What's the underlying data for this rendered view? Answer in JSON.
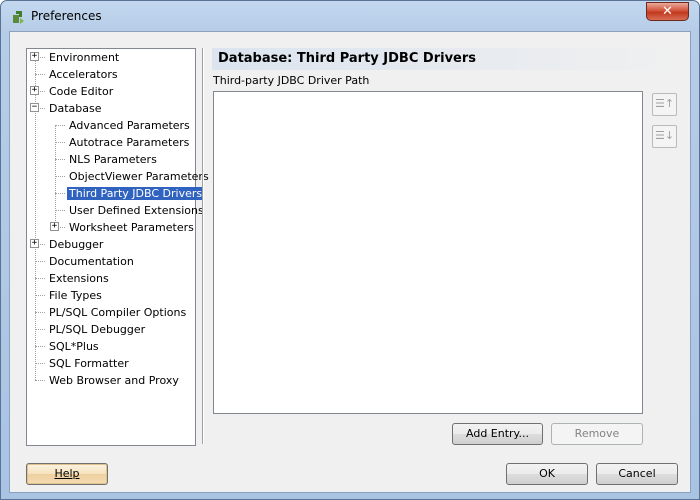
{
  "window": {
    "title": "Preferences",
    "close_glyph": "✕"
  },
  "tree": {
    "items": [
      {
        "label": "Environment",
        "expander": "+"
      },
      {
        "label": "Accelerators"
      },
      {
        "label": "Code Editor",
        "expander": "+"
      },
      {
        "label": "Database",
        "expander": "−"
      },
      {
        "label": "Advanced Parameters"
      },
      {
        "label": "Autotrace Parameters"
      },
      {
        "label": "NLS Parameters"
      },
      {
        "label": "ObjectViewer Parameters"
      },
      {
        "label": "Third Party JDBC Drivers",
        "selected": true
      },
      {
        "label": "User Defined Extensions"
      },
      {
        "label": "Worksheet Parameters",
        "expander": "+"
      },
      {
        "label": "Debugger",
        "expander": "+"
      },
      {
        "label": "Documentation"
      },
      {
        "label": "Extensions"
      },
      {
        "label": "File Types"
      },
      {
        "label": "PL/SQL Compiler Options"
      },
      {
        "label": "PL/SQL Debugger"
      },
      {
        "label": "SQL*Plus"
      },
      {
        "label": "SQL Formatter"
      },
      {
        "label": "Web Browser and Proxy"
      }
    ]
  },
  "panel": {
    "title": "Database: Third Party JDBC Drivers",
    "field_label": "Third-party JDBC Driver Path",
    "move_up_glyph": "☰↑",
    "move_down_glyph": "☰↓",
    "add_entry": "Add Entry...",
    "remove": "Remove"
  },
  "footer": {
    "help": "Help",
    "ok": "OK",
    "cancel": "Cancel"
  }
}
